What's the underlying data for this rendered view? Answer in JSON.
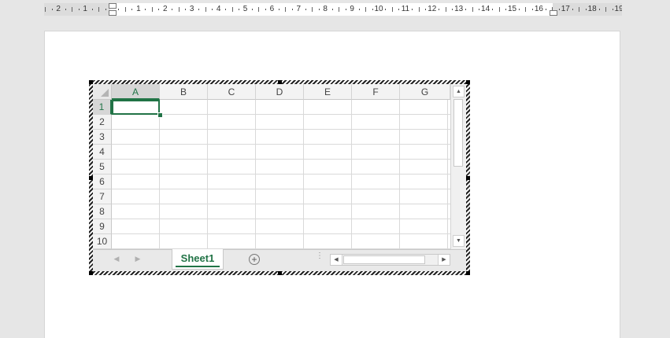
{
  "ruler": {
    "numbers": [
      "2",
      "1",
      "1",
      "2",
      "3",
      "4",
      "5",
      "6",
      "7",
      "8",
      "9",
      "10",
      "11",
      "12",
      "13",
      "14",
      "15",
      "16",
      "17",
      "18",
      "19"
    ]
  },
  "spreadsheet": {
    "columns": [
      "A",
      "B",
      "C",
      "D",
      "E",
      "F",
      "G"
    ],
    "rows": [
      "1",
      "2",
      "3",
      "4",
      "5",
      "6",
      "7",
      "8",
      "9",
      "10"
    ],
    "active_cell": "A1",
    "sheet_tab": "Sheet1",
    "add_sheet_symbol": "+",
    "accent_color": "#217346"
  },
  "icons": {
    "scroll_up": "▲",
    "scroll_down": "▼",
    "scroll_left": "◀",
    "scroll_right": "▶",
    "prev_sheet": "◀",
    "next_sheet": "▶",
    "split_handle": "⋮"
  }
}
